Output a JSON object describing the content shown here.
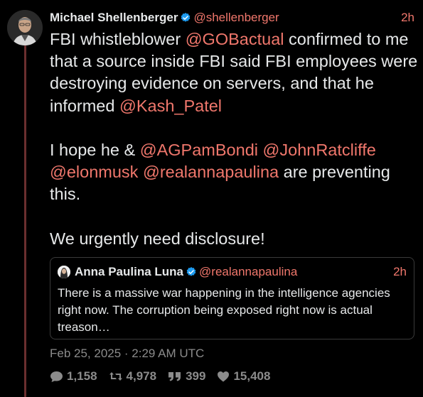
{
  "tweet": {
    "author_name": "Michael Shellenberger",
    "author_handle": "@shellenberger",
    "time": "2h",
    "line1_pre": "FBI whistleblower ",
    "line1_mention": "@GOBactual",
    "line1_post": " confirmed to me that a source inside FBI said FBI employees were destroying evidence on servers, and that he informed ",
    "line1_mention2": " @Kash_Patel",
    "line2_pre": "I hope he & ",
    "mentions": [
      "@AGPamBondi",
      "@JohnRatcliffe",
      "@elonmusk",
      "@realannapaulina"
    ],
    "line2_post": " are preventing this.",
    "line3": "We urgently need disclosure!",
    "timestamp": "Feb 25, 2025 · 2:29 AM UTC"
  },
  "quote": {
    "author_name": "Anna Paulina Luna",
    "author_handle": "@realannapaulina",
    "time": "2h",
    "text": "There is a massive war happening in the intelligence agencies right now. The corruption being exposed right now is actual treason…"
  },
  "stats": {
    "replies": "1,158",
    "retweets": "4,978",
    "quotes": "399",
    "likes": "15,408"
  },
  "icons": {
    "verified": "verified-badge-icon",
    "reply": "comment-icon",
    "retweet": "retweet-icon",
    "quote": "quote-icon",
    "like": "heart-icon"
  },
  "colors": {
    "accent": "#f0776c",
    "verified": "#1d9bf0",
    "muted": "#8b8b8b",
    "thread_line": "#6b2f2f"
  }
}
